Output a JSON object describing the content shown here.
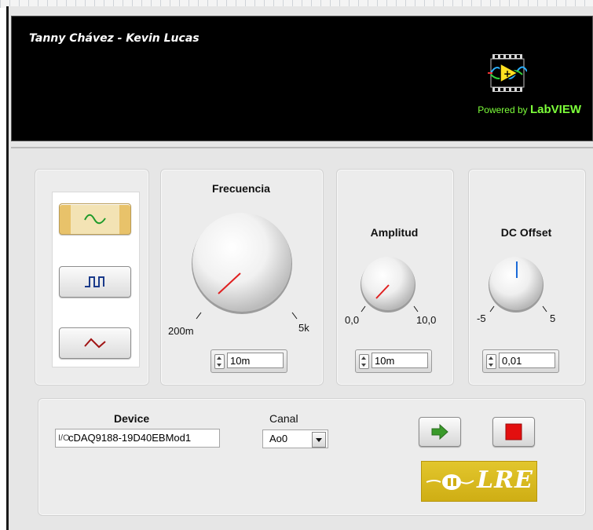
{
  "header": {
    "authors": "Tanny Chávez - Kevin Lucas",
    "powered_prefix": "Powered by",
    "powered_brand": "LabVIEW"
  },
  "waveform_selector": {
    "options": [
      {
        "name": "sine",
        "icon": "sine-wave-icon",
        "color": "#1e9a2a",
        "selected": true
      },
      {
        "name": "square",
        "icon": "square-wave-icon",
        "color": "#1a3a8a",
        "selected": false
      },
      {
        "name": "triangle",
        "icon": "triangle-wave-icon",
        "color": "#a01414",
        "selected": false
      }
    ]
  },
  "frecuencia": {
    "title": "Frecuencia",
    "min_label": "200m",
    "max_label": "5k",
    "value": "10m",
    "indicator_color": "#e02020"
  },
  "amplitud": {
    "title": "Amplitud",
    "min_label": "0,0",
    "max_label": "10,0",
    "value": "10m",
    "indicator_color": "#e02020"
  },
  "dc_offset": {
    "title": "DC Offset",
    "min_label": "-5",
    "max_label": "5",
    "value": "0,01",
    "indicator_color": "#1a6ad8"
  },
  "device": {
    "label": "Device",
    "io_prefix": "I/O",
    "value": "cDAQ9188-19D40EBMod1"
  },
  "canal": {
    "label": "Canal",
    "value": "Ao0"
  },
  "controls": {
    "run_color": "#3a9a2a",
    "stop_color": "#e30f0f"
  },
  "logo": {
    "text": "LRE",
    "background": "#d9b81e"
  }
}
